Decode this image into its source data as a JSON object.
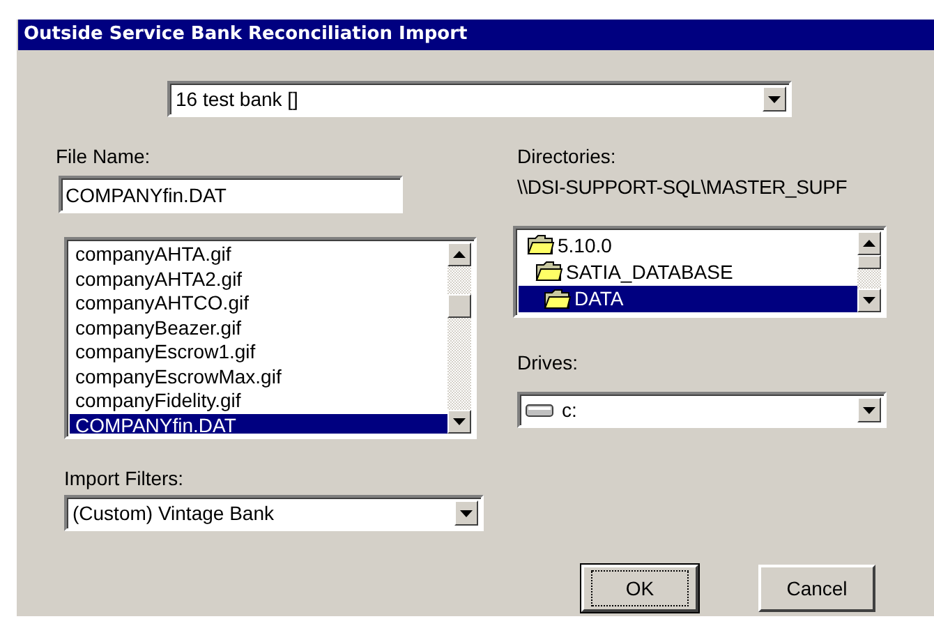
{
  "window": {
    "title": "Outside Service Bank Reconciliation Import"
  },
  "bank_select": {
    "value": "16 test bank []"
  },
  "file_name": {
    "label": "File Name:",
    "value": "COMPANYfin.DAT"
  },
  "files": [
    {
      "name": "companyAHTA.gif",
      "selected": false
    },
    {
      "name": "companyAHTA2.gif",
      "selected": false
    },
    {
      "name": "companyAHTCO.gif",
      "selected": false
    },
    {
      "name": "companyBeazer.gif",
      "selected": false
    },
    {
      "name": "companyEscrow1.gif",
      "selected": false
    },
    {
      "name": "companyEscrowMax.gif",
      "selected": false
    },
    {
      "name": "companyFidelity.gif",
      "selected": false
    },
    {
      "name": "COMPANYfin.DAT",
      "selected": true
    }
  ],
  "import_filters": {
    "label": "Import Filters:",
    "value": "(Custom) Vintage Bank"
  },
  "directories": {
    "label": "Directories:",
    "path": "\\\\DSI-SUPPORT-SQL\\MASTER_SUPF",
    "tree": [
      {
        "name": "5.10.0",
        "selected": false,
        "children": [
          {
            "name": "SATIA_DATABASE",
            "selected": false,
            "children": [
              {
                "name": "DATA",
                "selected": true
              }
            ]
          }
        ]
      }
    ]
  },
  "drives": {
    "label": "Drives:",
    "value": "c:"
  },
  "buttons": [
    {
      "label": "OK",
      "default": true
    },
    {
      "label": "Cancel",
      "default": false
    }
  ]
}
